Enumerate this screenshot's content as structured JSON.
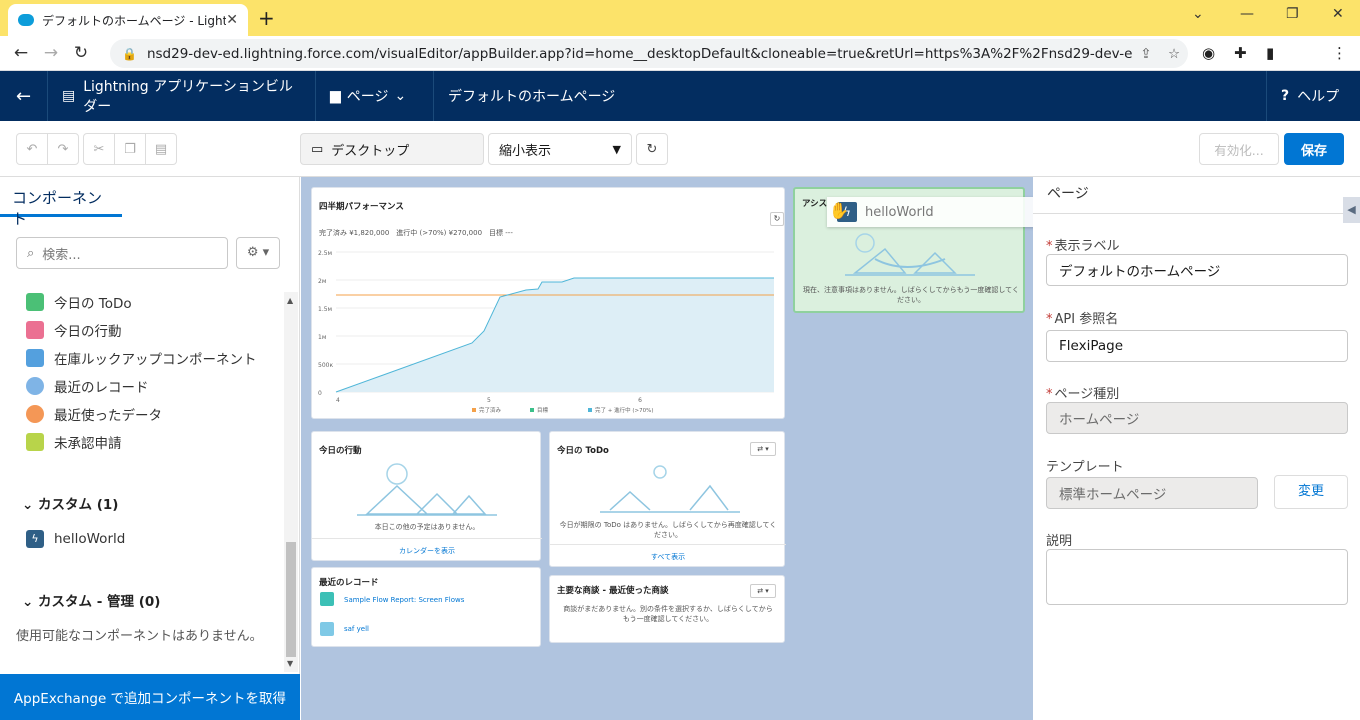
{
  "browser": {
    "tab_title": "デフォルトのホームページ - Lightning",
    "url": "nsd29-dev-ed.lightning.force.com/visualEditor/appBuilder.app?id=home__desktopDefault&cloneable=true&retUrl=https%3A%2F%2Fnsd29-dev-ed.lightnin..."
  },
  "header": {
    "app_name": "Lightning アプリケーションビルダー",
    "page_menu": "ページ",
    "page_title": "デフォルトのホームページ",
    "help": "ヘルプ"
  },
  "toolbar": {
    "device": "デスクトップ",
    "zoom": "縮小表示",
    "activate": "有効化...",
    "save": "保存"
  },
  "left": {
    "tab": "コンポーネント",
    "search_placeholder": "検索...",
    "components": [
      {
        "label": "今日の ToDo",
        "color": "#4bc076"
      },
      {
        "label": "今日の行動",
        "color": "#eb7092"
      },
      {
        "label": "在庫ルックアップコンポーネント",
        "color": "#54a0de"
      },
      {
        "label": "最近のレコード",
        "color": "#7fb4e6"
      },
      {
        "label": "最近使ったデータ",
        "color": "#f49756"
      },
      {
        "label": "未承認申請",
        "color": "#b8d44a"
      }
    ],
    "custom_section": "カスタム (1)",
    "custom_item": "helloWorld",
    "managed_section": "カスタム - 管理 (0)",
    "managed_empty": "使用可能なコンポーネントはありません。",
    "appexchange": "AppExchange で追加コンポーネントを取得"
  },
  "canvas": {
    "perf_title": "四半期パフォーマンス",
    "perf_stats": "完了済み ¥1,820,000　進行中 (>70%) ¥270,000　目標 ---",
    "chart_data": {
      "type": "line",
      "x_ticks": [
        "4",
        "5",
        "6"
      ],
      "y_ticks": [
        "2.5м",
        "2м",
        "1.5м",
        "1м",
        "500к",
        "0"
      ],
      "legend": [
        "完了済み",
        "目標",
        "完了 + 進行中 (>70%)"
      ],
      "goal_color": "#f4a14a",
      "line_color": "#4fb6d8"
    },
    "assist_title": "アシス",
    "assist_empty": "現在、注意事項はありません。しばらくしてからもう一度確認してください。",
    "drag_label": "helloWorld",
    "events_title": "今日の行動",
    "events_empty": "本日この他の予定はありません。",
    "events_link": "カレンダーを表示",
    "todo_title": "今日の ToDo",
    "todo_empty": "今日が期限の ToDo はありません。しばらくしてから再度確認してください。",
    "todo_link": "すべて表示",
    "recent_title": "最近のレコード",
    "recent_items": [
      "Sample Flow Report: Screen Flows",
      "saf yell"
    ],
    "deals_title": "主要な商談 - 最近使った商談",
    "deals_empty": "商談がまだありません。別の条件を選択するか、しばらくしてからもう一度確認してください。"
  },
  "right": {
    "tab": "ページ",
    "label_label": "表示ラベル",
    "label_value": "デフォルトのホームページ",
    "api_label": "API 参照名",
    "api_value": "FlexiPage",
    "type_label": "ページ種別",
    "type_value": "ホームページ",
    "template_label": "テンプレート",
    "template_value": "標準ホームページ",
    "change": "変更",
    "desc_label": "説明"
  }
}
